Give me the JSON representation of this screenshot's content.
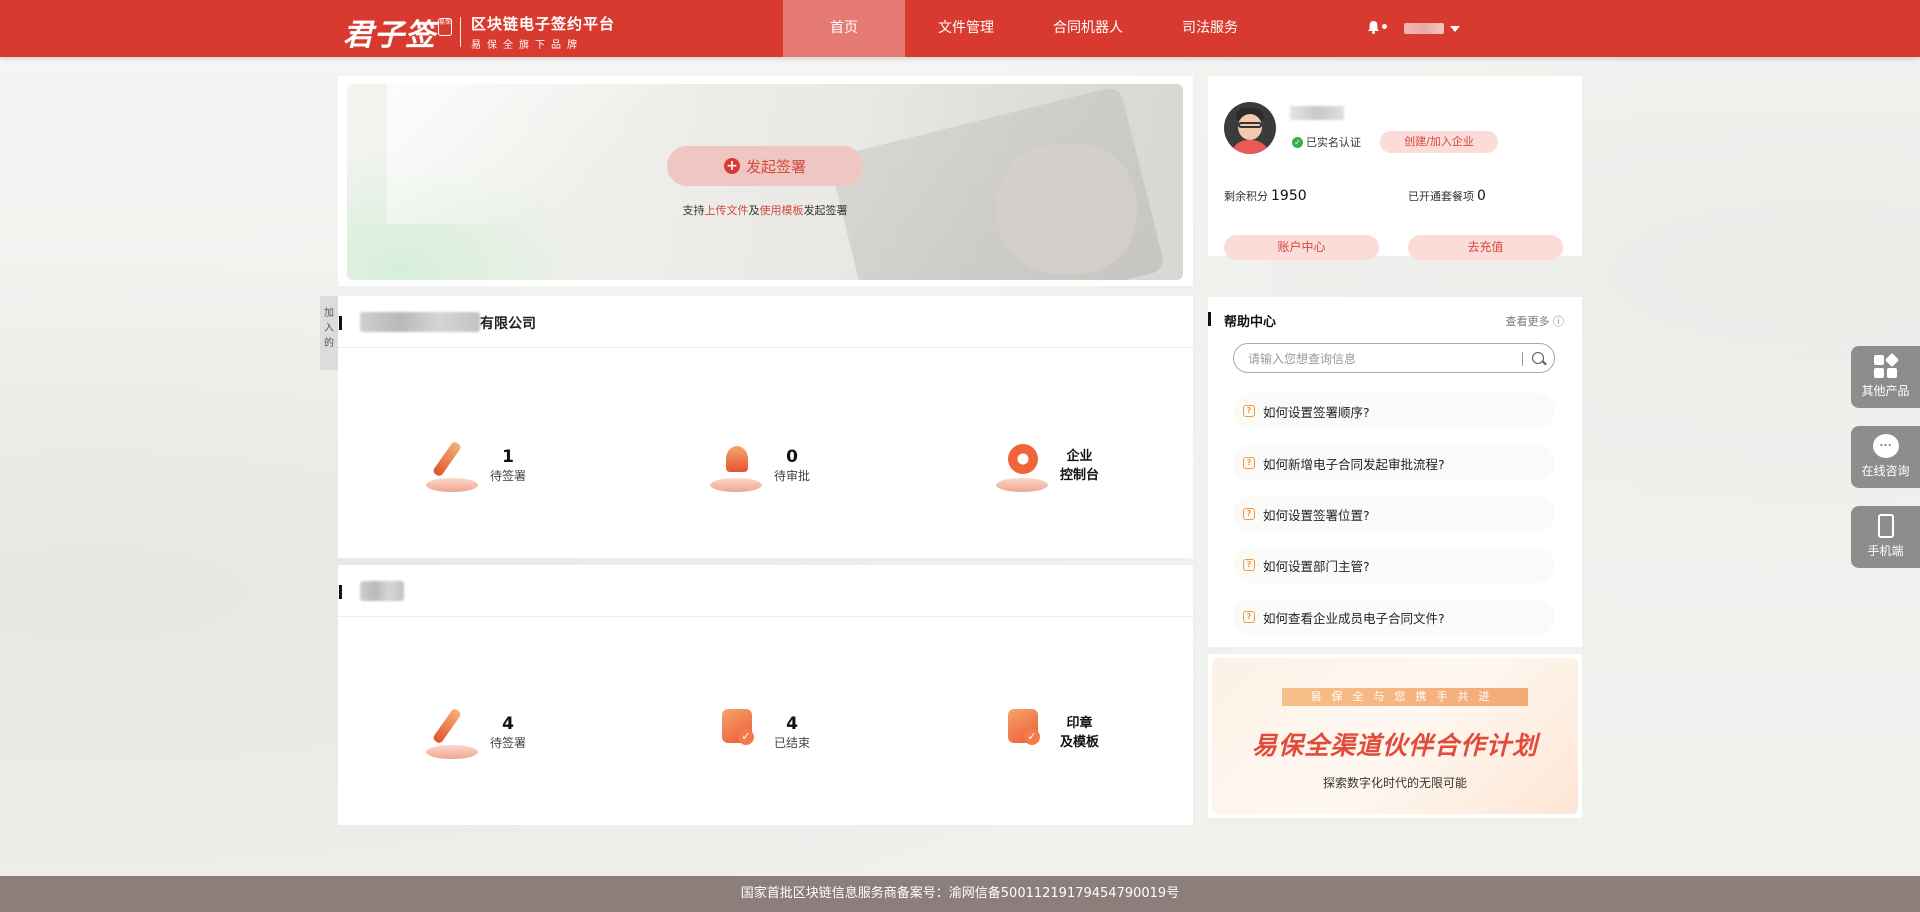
{
  "header": {
    "logo_script": "君子签",
    "logo_seal": "易保",
    "logo_main": "区块链电子签约平台",
    "logo_sub": "易保全旗下品牌",
    "nav": [
      "首页",
      "文件管理",
      "合同机器人",
      "司法服务"
    ],
    "active_nav": "首页"
  },
  "banner": {
    "start_button": "发起签署",
    "hint_prefix": "支持",
    "hint_link1": "上传文件",
    "hint_mid": "及",
    "hint_link2": "使用模板",
    "hint_suffix": "发起签署"
  },
  "side_tab": "加入的",
  "company1": {
    "name_suffix": "有限公司",
    "stats": [
      {
        "num": "1",
        "label": "待签署"
      },
      {
        "num": "0",
        "label": "待审批"
      },
      {
        "line1": "企业",
        "line2": "控制台"
      }
    ]
  },
  "company2": {
    "stats": [
      {
        "num": "4",
        "label": "待签署"
      },
      {
        "num": "4",
        "label": "已结束"
      },
      {
        "line1": "印章",
        "line2": "及模板"
      }
    ]
  },
  "user": {
    "verified": "已实名认证",
    "create_button": "创建/加入企业",
    "points_label": "剩余积分",
    "points_value": "1950",
    "plans_label": "已开通套餐项",
    "plans_value": "0",
    "account_button": "账户中心",
    "recharge_button": "去充值"
  },
  "help": {
    "title": "帮助中心",
    "more": "查看更多",
    "search_placeholder": "请输入您想查询信息",
    "faqs": [
      "如何设置签署顺序?",
      "如何新增电子合同发起审批流程?",
      "如何设置签署位置?",
      "如何设置部门主管?",
      "如何查看企业成员电子合同文件?"
    ]
  },
  "promo": {
    "tag": "易保全与您携手共进",
    "title": "易保全渠道伙伴合作计划",
    "subtitle": "探索数字化时代的无限可能"
  },
  "float": {
    "other_products": "其他产品",
    "online_consult": "在线咨询",
    "mobile": "手机端"
  },
  "footer": {
    "text": "国家首批区块链信息服务商备案号：渝网信备50011219179454790019号"
  },
  "colors": {
    "brand_red": "#d93a2f",
    "nav_active": "#e57a72",
    "footer": "#8c7e7b"
  }
}
